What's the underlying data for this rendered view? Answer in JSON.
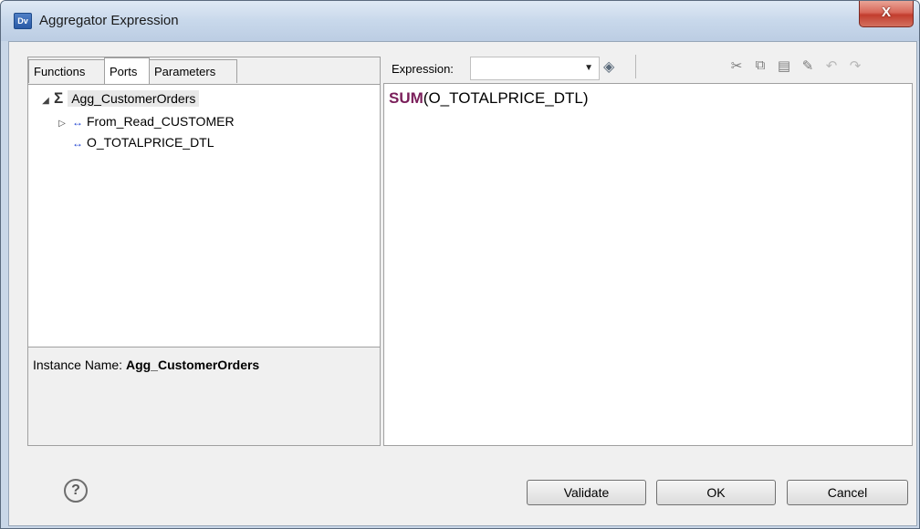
{
  "window": {
    "app_icon_text": "Dv",
    "title": "Aggregator Expression",
    "close_label": "X"
  },
  "left_panel": {
    "tabs": [
      {
        "label": "Functions",
        "active": false
      },
      {
        "label": "Ports",
        "active": true
      },
      {
        "label": "Parameters",
        "active": false
      }
    ],
    "tree": {
      "root": {
        "label": "Agg_CustomerOrders",
        "icon": "sigma-icon",
        "expanded": true
      },
      "children": [
        {
          "label": "From_Read_CUSTOMER",
          "icon": "port-arrow-icon",
          "expandable": true
        },
        {
          "label": "O_TOTALPRICE_DTL",
          "icon": "port-arrow-icon",
          "expandable": false
        }
      ]
    },
    "instance_label": "Instance Name:",
    "instance_value": "Agg_CustomerOrders"
  },
  "expression_panel": {
    "label": "Expression:",
    "combo_value": "",
    "toolbar": [
      "pin-icon",
      "cut-icon",
      "copy-icon",
      "paste-icon",
      "format-icon",
      "undo-icon",
      "redo-icon"
    ],
    "expression_fn": "SUM",
    "expression_args": "(O_TOTALPRICE_DTL)"
  },
  "footer": {
    "help_label": "?",
    "validate_label": "Validate",
    "ok_label": "OK",
    "cancel_label": "Cancel"
  },
  "colors": {
    "function_keyword": "#7a1e5a",
    "port_icon": "#1b3fcf",
    "close_button": "#c23d2e"
  }
}
